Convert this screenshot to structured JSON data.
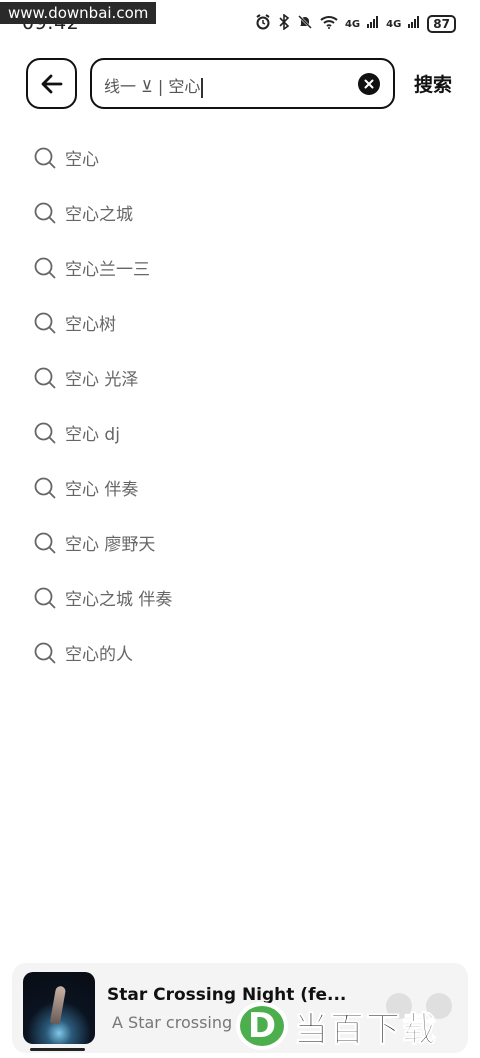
{
  "status_bar": {
    "time": "09:42",
    "watermark": "www.downbai.com",
    "signal_1": "4G",
    "signal_2": "4G",
    "battery": "87"
  },
  "header": {
    "search_value": "线一 ⊻ | 空心",
    "search_button": "搜索"
  },
  "suggestions": [
    "空心",
    "空心之城",
    "空心兰一三",
    "空心树",
    "空心 光泽",
    "空心 dj",
    "空心 伴奏",
    "空心 廖野天",
    "空心之城 伴奏",
    "空心的人"
  ],
  "mini_player": {
    "title": "Star Crossing Night (fe...",
    "subtitle": "A Star crossing night"
  },
  "logo_watermark": {
    "letter": "D",
    "text": "当百下载"
  },
  "colors": {
    "accent_green": "#4cae4c",
    "text_primary": "#111111",
    "text_secondary": "#666666"
  },
  "icons": [
    "alarm-icon",
    "bluetooth-icon",
    "mute-icon",
    "wifi-icon",
    "back-arrow-icon",
    "clear-icon",
    "search-icon"
  ]
}
